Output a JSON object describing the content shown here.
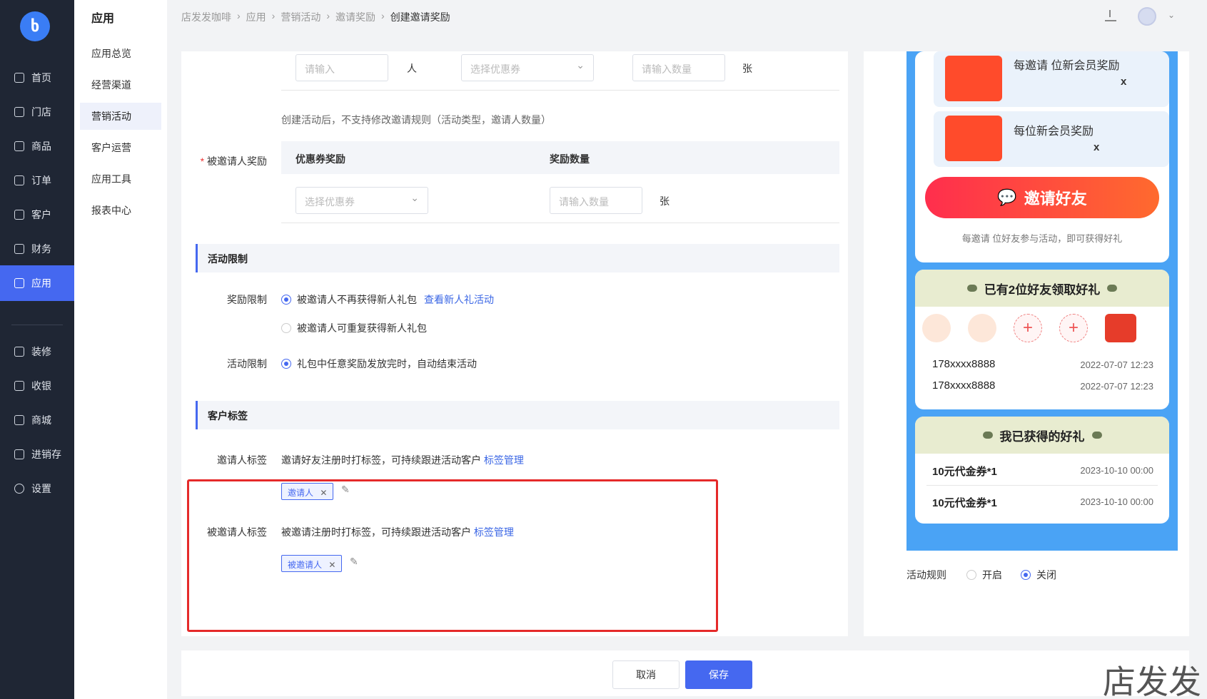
{
  "nav": {
    "logo": "ხ",
    "items": [
      {
        "label": "首页"
      },
      {
        "label": "门店"
      },
      {
        "label": "商品"
      },
      {
        "label": "订单"
      },
      {
        "label": "客户"
      },
      {
        "label": "财务"
      },
      {
        "label": "应用"
      },
      {
        "label": "装修"
      },
      {
        "label": "收银"
      },
      {
        "label": "商城"
      },
      {
        "label": "进销存"
      },
      {
        "label": "设置"
      }
    ]
  },
  "submenu": {
    "title": "应用",
    "items": [
      {
        "label": "应用总览"
      },
      {
        "label": "经营渠道"
      },
      {
        "label": "营销活动"
      },
      {
        "label": "客户运营"
      },
      {
        "label": "应用工具"
      },
      {
        "label": "报表中心"
      }
    ]
  },
  "breadcrumb": [
    "店发发咖啡",
    "应用",
    "营销活动",
    "邀请奖励",
    "创建邀请奖励"
  ],
  "form": {
    "row1": {
      "input_placeholder": "请输入",
      "unit1": "人",
      "select_placeholder": "选择优惠券",
      "qty_placeholder": "请输入数量",
      "unit2": "张"
    },
    "note": "创建活动后，不支持修改邀请规则（活动类型，邀请人数量）",
    "invitee_reward": {
      "label": "被邀请人奖励",
      "col1": "优惠券奖励",
      "col2": "奖励数量",
      "select_placeholder": "选择优惠券",
      "qty_placeholder": "请输入数量",
      "unit": "张"
    },
    "section_limit": "活动限制",
    "reward_limit": {
      "label": "奖励限制",
      "opt1": "被邀请人不再获得新人礼包",
      "link": "查看新人礼活动",
      "opt2": "被邀请人可重复获得新人礼包"
    },
    "activity_limit": {
      "label": "活动限制",
      "opt1": "礼包中任意奖励发放完时，自动结束活动"
    },
    "section_tag": "客户标签",
    "inviter_tag": {
      "label": "邀请人标签",
      "desc": "邀请好友注册时打标签，可持续跟进活动客户",
      "link": "标签管理",
      "tag": "邀请人"
    },
    "invitee_tag": {
      "label": "被邀请人标签",
      "desc": "被邀请注册时打标签，可持续跟进活动客户",
      "link": "标签管理",
      "tag": "被邀请人"
    },
    "cancel": "取消",
    "save": "保存"
  },
  "preview": {
    "coupon1_text": "每邀请 位新会员奖励",
    "coupon1_x": "x",
    "coupon2_text": "每位新会员奖励",
    "coupon2_x": "x",
    "invite_button": "邀请好友",
    "invite_hint": "每邀请 位好友参与活动，即可获得好礼",
    "friends_title": "已有2位好友领取好礼",
    "friends": [
      {
        "phone": "178xxxx8888",
        "time": "2022-07-07 12:23"
      },
      {
        "phone": "178xxxx8888",
        "time": "2022-07-07 12:23"
      }
    ],
    "gifts_title": "我已获得的好礼",
    "gifts": [
      {
        "name": "10元代金券*1",
        "time": "2023-10-10 00:00"
      },
      {
        "name": "10元代金券*1",
        "time": "2023-10-10 00:00"
      }
    ],
    "rule_label": "活动规则",
    "rule_on": "开启",
    "rule_off": "关闭"
  },
  "watermark": "店发发"
}
